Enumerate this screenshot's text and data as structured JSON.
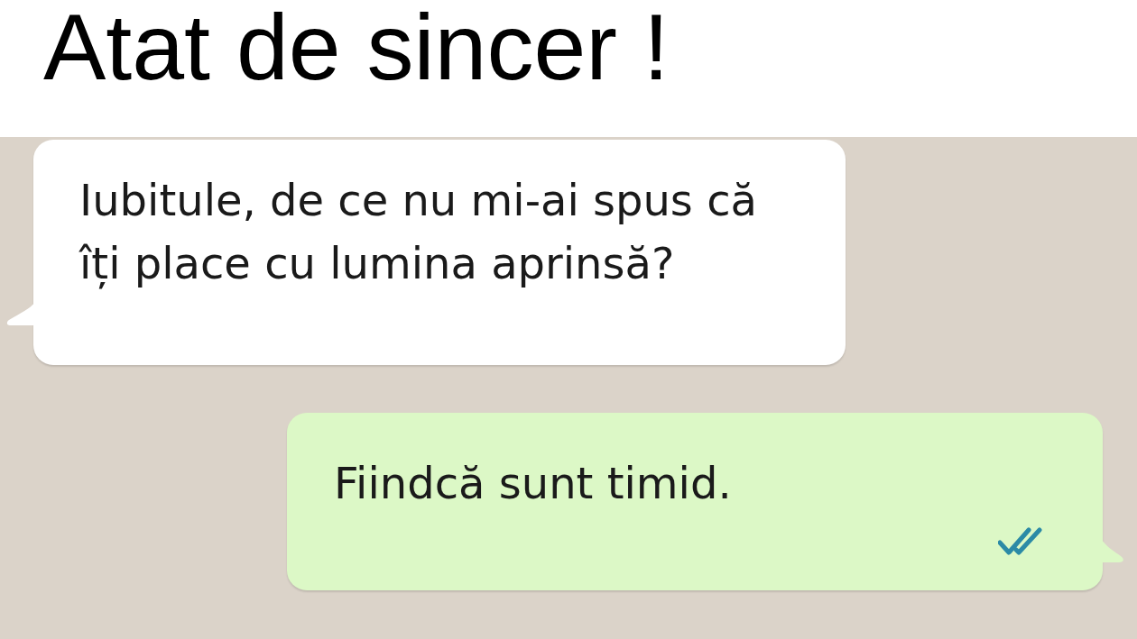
{
  "title": "Atat de sincer !",
  "messages": [
    {
      "kind": "incoming",
      "text": "Iubitule, de ce nu mi-ai spus că îți place cu lumina aprinsă?"
    },
    {
      "kind": "outgoing",
      "text": "Fiindcă sunt timid.",
      "read": true
    }
  ]
}
